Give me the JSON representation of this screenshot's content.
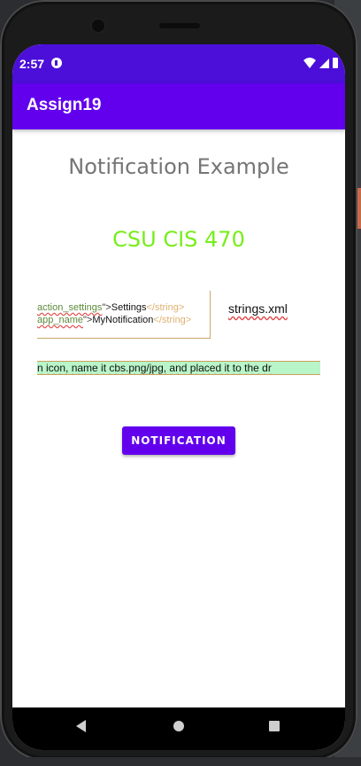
{
  "status_bar": {
    "time": "2:57"
  },
  "app_bar": {
    "title": "Assign19"
  },
  "main": {
    "heading": "Notification Example",
    "course": "CSU CIS 470",
    "snippet": {
      "line1_attr": "action_settings",
      "line1_mid": "\">",
      "line1_text": "Settings",
      "line1_tag": "</string>",
      "line2_attr": "app_name",
      "line2_mid": "\">",
      "line2_text": "MyNotification",
      "line2_tag": "</string>"
    },
    "strings_label": "strings.xml",
    "strip_text": "n icon, name it cbs.png/jpg, and placed it to the dr",
    "button_label": "NOTIFICATION"
  },
  "colors": {
    "status_bar": "#4b0fd9",
    "app_bar": "#6200ee",
    "heading": "#757575",
    "course": "#76ee1a",
    "button": "#6200ee"
  },
  "icons": [
    "app-status-icon",
    "wifi-icon",
    "signal-icon",
    "battery-icon",
    "back-icon",
    "home-icon",
    "recents-icon"
  ]
}
